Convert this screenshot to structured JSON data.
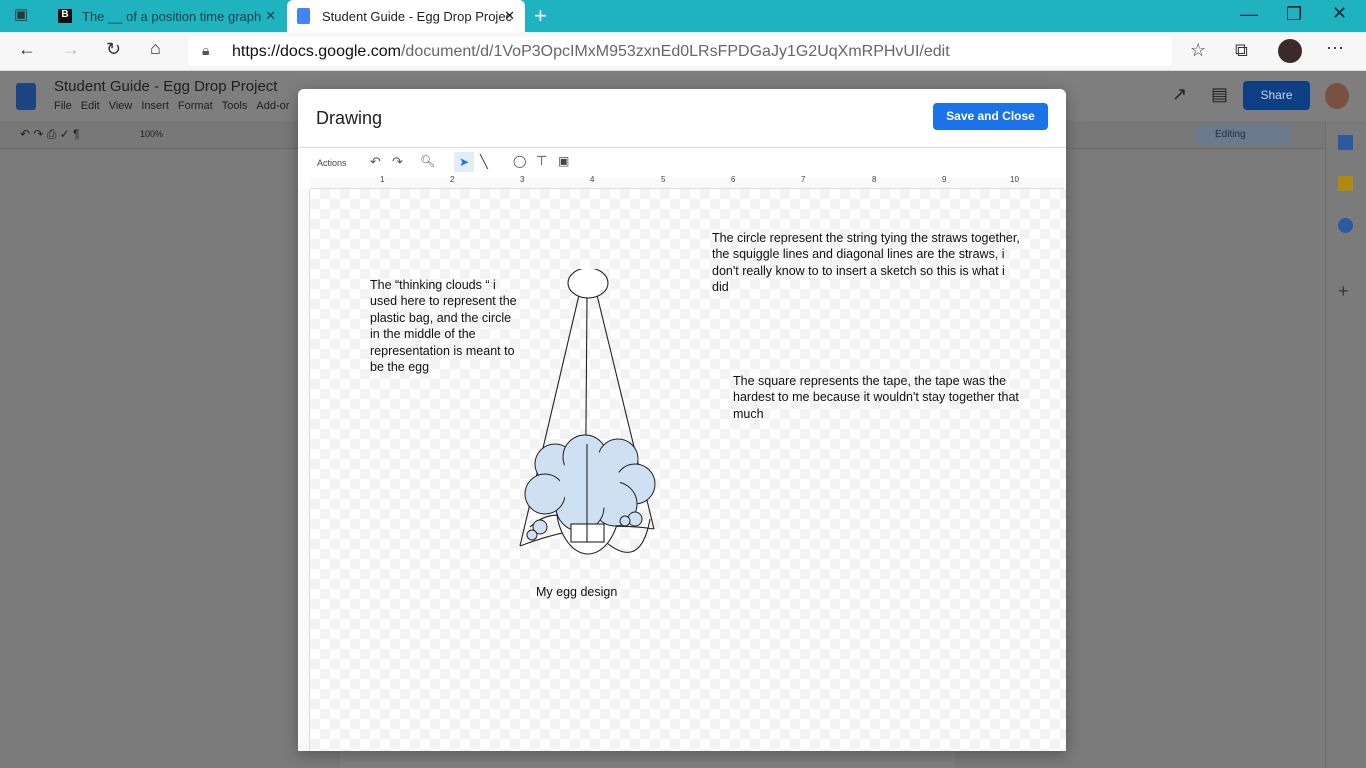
{
  "browser": {
    "tabs": [
      {
        "label": "The __ of a position time graph"
      },
      {
        "label": "Student Guide - Egg Drop Projec"
      }
    ],
    "url_host": "https://docs.google.com",
    "url_path": "/document/d/1VoP3OpcIMxM953zxnEd0LRsFPDGaJy1G2UqXmRPHvUI/edit"
  },
  "docs": {
    "title": "Student Guide - Egg Drop Project",
    "menu": [
      "File",
      "Edit",
      "View",
      "Insert",
      "Format",
      "Tools",
      "Add-or"
    ],
    "zoom": "100%",
    "share": "Share",
    "mode": "Editing"
  },
  "drawing": {
    "title": "Drawing",
    "save": "Save and Close",
    "actions": "Actions",
    "ruler": [
      "1",
      "2",
      "3",
      "4",
      "5",
      "6",
      "7",
      "8",
      "9",
      "10"
    ],
    "notes": {
      "bag": "The “thinking clouds “ i used here to represent the plastic bag, and the circle in the middle of the representation is meant to be the egg",
      "circle": "The circle represent the string tying the straws together, the squiggle lines and diagonal lines are the straws, i don't really know to to insert a sketch so this is what i did",
      "tape": "The square represents the tape, the tape was the hardest to me because it wouldn't stay together that much",
      "caption": "My egg design"
    }
  },
  "colors": {
    "accent": "#1a73e8",
    "tabbar": "#1fb3c0",
    "cloud": "#cfe0f3"
  }
}
